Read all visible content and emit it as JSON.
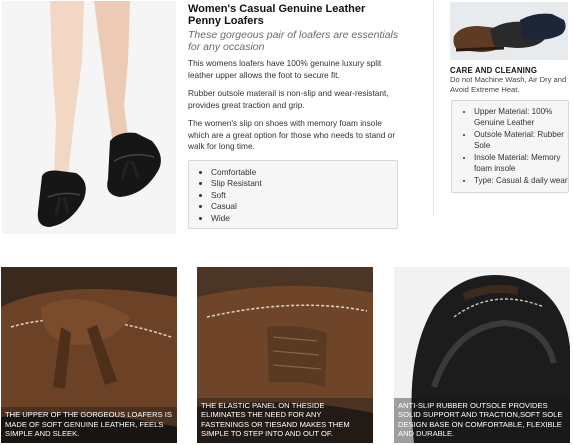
{
  "product": {
    "title": "Women's Casual Genuine Leather Penny Loafers",
    "subtitle": "These gorgeous pair of loafers are essentials for any occasion",
    "paragraphs": [
      "This womens loafers have 100% genuine luxury split leather upper allows the foot to secure fit.",
      "Rubber outsole materail is non-slip and wear-resistant, provides great traction and grip.",
      "The women's slip on shoes with memory foam insole which are a great option for those who needs to stand or walk for long time."
    ],
    "features": [
      "Comfortable",
      "Slip Resistant",
      "Soft",
      "Casual",
      "Wide"
    ]
  },
  "care": {
    "heading": "CARE AND CLEANING",
    "text": "Do not Machine Wash, Air Dry and Avoid Extreme Heat."
  },
  "specs": [
    "Upper Material: 100% Genuine Leather",
    "Outsole Material: Rubber Sole",
    "Insole Material: Memory foam insole",
    "Type: Casual & daily wear"
  ],
  "panels": [
    {
      "caption": "THE UPPER OF THE GORGEOUS LOAFERS IS MADE OF SOFT GENUINE LEATHER, FEELS SIMPLE AND SLEEK."
    },
    {
      "caption": "THE ELASTIC PANEL ON THESIDE ELIMINATES THE NEED FOR ANY FASTENINGS OR TIESAND MAKES THEM SIMPLE TO STEP INTO AND OUT OF."
    },
    {
      "caption": "ANTI-SLIP RUBBER OUTSOLE PROVIDES SOLID SUPPORT AND TRACTION,SOFT SOLE DESIGN BASE ON COMFORTABLE, FLEXIBLE AND DURABLE."
    }
  ],
  "colors": {
    "leather_brown": "#6b4226",
    "dark_leather": "#1b1b1b",
    "stitch": "#d9cfbf"
  }
}
